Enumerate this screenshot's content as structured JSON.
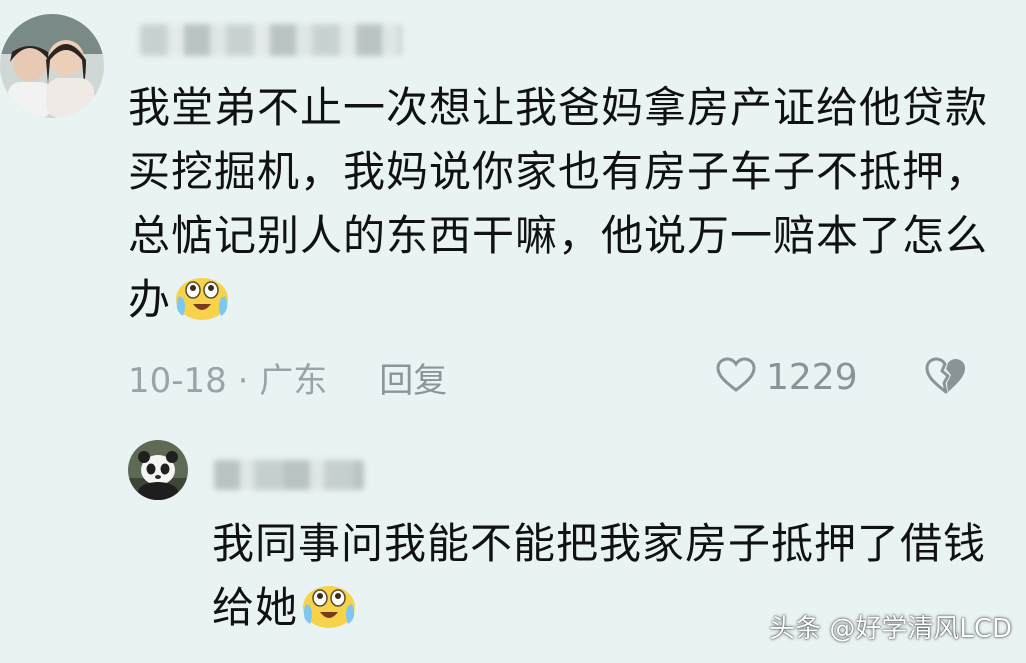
{
  "comment1": {
    "text": "我堂弟不止一次想让我爸妈拿房产证给他贷款买挖掘机，我妈说你家也有房子车子不抵押，总惦记别人的东西干嘛，他说万一赔本了怎么办",
    "emoji": "crying-laughing-emoji",
    "date_location": "10-18 · 广东",
    "reply_label": "回复",
    "like_count": "1229"
  },
  "comment2": {
    "text": "我同事问我能不能把我家房子抵押了借钱给她",
    "emoji": "crying-laughing-emoji"
  },
  "watermark": "头条 @好学清风LCD",
  "icons": {
    "like": "heart-outline-icon",
    "dislike": "broken-heart-icon"
  }
}
